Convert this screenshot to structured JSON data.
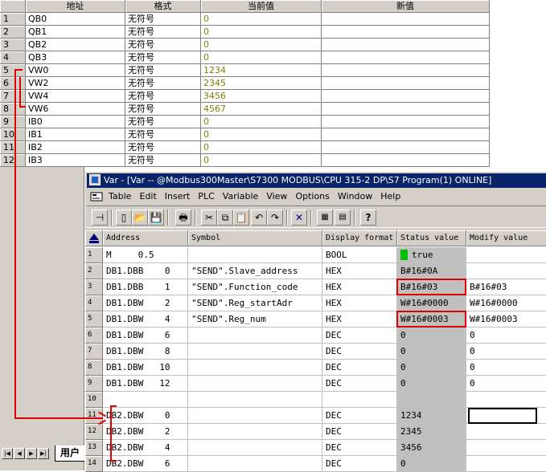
{
  "status_chart": {
    "columns": [
      "地址",
      "格式",
      "当前值",
      "新值"
    ],
    "rows": [
      {
        "num": "1",
        "address": "QB0",
        "format": "无符号",
        "value": "0",
        "new": ""
      },
      {
        "num": "2",
        "address": "QB1",
        "format": "无符号",
        "value": "0",
        "new": ""
      },
      {
        "num": "3",
        "address": "QB2",
        "format": "无符号",
        "value": "0",
        "new": ""
      },
      {
        "num": "4",
        "address": "QB3",
        "format": "无符号",
        "value": "0",
        "new": ""
      },
      {
        "num": "5",
        "address": "VW0",
        "format": "无符号",
        "value": "1234",
        "new": ""
      },
      {
        "num": "6",
        "address": "VW2",
        "format": "无符号",
        "value": "2345",
        "new": ""
      },
      {
        "num": "7",
        "address": "VW4",
        "format": "无符号",
        "value": "3456",
        "new": ""
      },
      {
        "num": "8",
        "address": "VW6",
        "format": "无符号",
        "value": "4567",
        "new": ""
      },
      {
        "num": "9",
        "address": "IB0",
        "format": "无符号",
        "value": "0",
        "new": ""
      },
      {
        "num": "10",
        "address": "IB1",
        "format": "无符号",
        "value": "0",
        "new": ""
      },
      {
        "num": "11",
        "address": "IB2",
        "format": "无符号",
        "value": "0",
        "new": ""
      },
      {
        "num": "12",
        "address": "IB3",
        "format": "无符号",
        "value": "0",
        "new": ""
      }
    ],
    "tab_label": "用户"
  },
  "var_window": {
    "title": "Var - [Var -- @Modbus300Master\\S7300 MODBUS\\CPU 315-2 DP\\S7 Program(1)  ONLINE]",
    "menu": [
      "Table",
      "Edit",
      "Insert",
      "PLC",
      "Variable",
      "View",
      "Options",
      "Window",
      "Help"
    ],
    "toolbar_icons": [
      "pin-icon",
      "new-icon",
      "open-icon",
      "save-icon",
      "print-icon",
      "cut-icon",
      "copy-icon",
      "paste-icon",
      "undo-icon",
      "redo-icon",
      "delete-icon",
      "online-icon",
      "monitor-icon",
      "help-icon"
    ],
    "columns": [
      "Address",
      "Symbol",
      "Display format",
      "Status value",
      "Modify value"
    ],
    "rows": [
      {
        "num": "1",
        "address": "M     0.5",
        "symbol": "",
        "format": "BOOL",
        "status": "true",
        "modify": ""
      },
      {
        "num": "2",
        "address": "DB1.DBB    0",
        "symbol": "\"SEND\".Slave_address",
        "format": "HEX",
        "status": "B#16#0A",
        "modify": ""
      },
      {
        "num": "3",
        "address": "DB1.DBB    1",
        "symbol": "\"SEND\".Function_code",
        "format": "HEX",
        "status": "B#16#03",
        "modify": "B#16#03"
      },
      {
        "num": "4",
        "address": "DB1.DBW    2",
        "symbol": "\"SEND\".Reg_startAdr",
        "format": "HEX",
        "status": "W#16#0000",
        "modify": "W#16#0000"
      },
      {
        "num": "5",
        "address": "DB1.DBW    4",
        "symbol": "\"SEND\".Reg_num",
        "format": "HEX",
        "status": "W#16#0003",
        "modify": "W#16#0003"
      },
      {
        "num": "6",
        "address": "DB1.DBW    6",
        "symbol": "",
        "format": "DEC",
        "status": "0",
        "modify": "0"
      },
      {
        "num": "7",
        "address": "DB1.DBW    8",
        "symbol": "",
        "format": "DEC",
        "status": "0",
        "modify": "0"
      },
      {
        "num": "8",
        "address": "DB1.DBW   10",
        "symbol": "",
        "format": "DEC",
        "status": "0",
        "modify": "0"
      },
      {
        "num": "9",
        "address": "DB1.DBW   12",
        "symbol": "",
        "format": "DEC",
        "status": "0",
        "modify": "0"
      },
      {
        "num": "10",
        "address": "",
        "symbol": "",
        "format": "",
        "status": "",
        "modify": ""
      },
      {
        "num": "11",
        "address": "DB2.DBW    0",
        "symbol": "",
        "format": "DEC",
        "status": "1234",
        "modify": ""
      },
      {
        "num": "12",
        "address": "DB2.DBW    2",
        "symbol": "",
        "format": "DEC",
        "status": "2345",
        "modify": ""
      },
      {
        "num": "13",
        "address": "DB2.DBW    4",
        "symbol": "",
        "format": "DEC",
        "status": "3456",
        "modify": ""
      },
      {
        "num": "14",
        "address": "DB2.DBW    6",
        "symbol": "",
        "format": "DEC",
        "status": "0",
        "modify": ""
      }
    ]
  },
  "colors": {
    "titlebar": "#0a246a",
    "annotation": "#e00000",
    "value_text": "#808000",
    "status_ok": "#00c000"
  }
}
